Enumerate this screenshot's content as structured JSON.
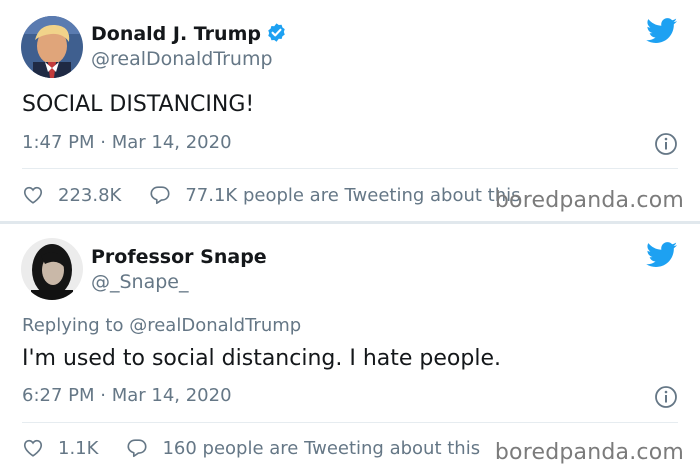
{
  "tweets": [
    {
      "author_name": "Donald J. Trump",
      "handle": "@realDonaldTrump",
      "verified": true,
      "text": "SOCIAL DISTANCING!",
      "timestamp": "1:47 PM · Mar 14, 2020",
      "likes": "223.8K",
      "tweeting_text": "77.1K people are Tweeting about this"
    },
    {
      "author_name": "Professor Snape",
      "handle": "@_Snape_",
      "reply_prefix": "Replying to",
      "reply_mention": "@realDonaldTrump",
      "text": "I'm used to social distancing. I hate people.",
      "timestamp": "6:27 PM · Mar 14, 2020",
      "likes": "1.1K",
      "tweeting_text": "160 people are Tweeting about this"
    }
  ],
  "watermark": "boredpanda.com",
  "colors": {
    "twitter_blue": "#1da1f2",
    "secondary_text": "#657786",
    "primary_text": "#14171a"
  },
  "icons": [
    "twitter-bird-icon",
    "verified-badge-icon",
    "info-icon",
    "heart-icon",
    "comment-bubble-icon"
  ]
}
